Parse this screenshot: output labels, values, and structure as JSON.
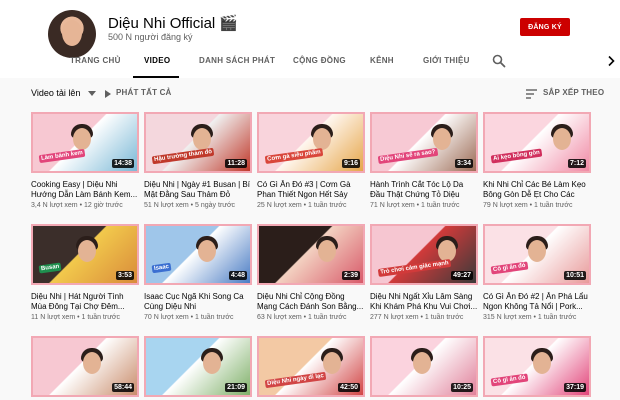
{
  "channel": {
    "name": "Diệu Nhi Official 🎬",
    "subscribers": "500 N người đăng ký",
    "subscribe_label": "ĐĂNG KÝ"
  },
  "tabs": [
    {
      "label": "TRANG CHỦ",
      "active": false
    },
    {
      "label": "VIDEO",
      "active": true
    },
    {
      "label": "DANH SÁCH PHÁT",
      "active": false
    },
    {
      "label": "CỘNG ĐỒNG",
      "active": false
    },
    {
      "label": "KÊNH",
      "active": false
    },
    {
      "label": "GIỚI THIỆU",
      "active": false
    }
  ],
  "toolbar": {
    "uploads_label": "Video tải lên",
    "play_all_label": "PHÁT TẤT CẢ",
    "sort_label": "SẮP XẾP THEO"
  },
  "videos": [
    {
      "title": "Cooking Easy | Diệu Nhi Hướng Dẫn Làm Bánh Kem...",
      "views": "3,4 N lượt xem",
      "age": "12 giờ trước",
      "duration": "14:38",
      "palette": [
        "#f7c8d2",
        "#7ab8d6",
        "#ffffff"
      ],
      "caption": "Làm bánh kem",
      "caption_bg": "#e2457a"
    },
    {
      "title": "Diệu Nhi | Ngày #1 Busan | Bí Mật Đằng Sau Thảm Đỏ",
      "views": "51 N lượt xem",
      "age": "5 ngày trước",
      "duration": "11:28",
      "palette": [
        "#f4d7dd",
        "#c0392b",
        "#f0f0f0"
      ],
      "caption": "Hậu trường thảm đỏ",
      "caption_bg": "#c0392b"
    },
    {
      "title": "Có Gì Ăn Đó #3 | Cơm Gà Phan Thiết Ngon Hết Sảy",
      "views": "25 N lượt xem",
      "age": "1 tuần trước",
      "duration": "9:16",
      "palette": [
        "#f9d4dc",
        "#e6a64a",
        "#fff7f0"
      ],
      "caption": "Cơm gà siêu phẩm",
      "caption_bg": "#d9463b"
    },
    {
      "title": "Hành Trình Cắt Tóc Lộ Da Đầu Thật Chứng Tỏ Diệu Nhi...",
      "views": "71 N lượt xem",
      "age": "1 tuần trước",
      "duration": "3:34",
      "palette": [
        "#f7c9d4",
        "#9c6b55",
        "#ffffff"
      ],
      "caption": "Diệu Nhi sẽ ra sao?",
      "caption_bg": "#e2457a"
    },
    {
      "title": "Khi Nhi Chỉ Các Bé Làm Kẹo Bông Gòn Dễ Ẹt Cho Các Bé...",
      "views": "79 N lượt xem",
      "age": "1 tuần trước",
      "duration": "7:12",
      "palette": [
        "#fbd6df",
        "#f08aa5",
        "#ffffff"
      ],
      "caption": "Ai kẹo bông gòn",
      "caption_bg": "#d12f5d"
    },
    {
      "title": "Diệu Nhi | Hát Người Tình Mùa Đông Tại Chợ Đêm...",
      "views": "11 N lượt xem",
      "age": "1 tuần trước",
      "duration": "3:53",
      "palette": [
        "#3b2e2a",
        "#d98b3a",
        "#f2c94c"
      ],
      "caption": "Busan",
      "caption_bg": "#1f8f4e"
    },
    {
      "title": "Isaac Cục Ngã Khi Song Ca Cùng Diệu Nhi",
      "views": "70 N lượt xem",
      "age": "1 tuần trước",
      "duration": "4:48",
      "palette": [
        "#9fc6ea",
        "#4a7cc4",
        "#ffffff"
      ],
      "caption": "Isaac",
      "caption_bg": "#3b6fd1"
    },
    {
      "title": "Diệu Nhi Chỉ Cộng Đồng Mạng Cách Đánh Son Bằng...",
      "views": "63 N lượt xem",
      "age": "1 tuần trước",
      "duration": "2:39",
      "palette": [
        "#2b1e1a",
        "#d85a6a",
        "#f3d1c1"
      ],
      "caption": "",
      "caption_bg": "#000000"
    },
    {
      "title": "Diệu Nhi Ngất Xỉu Lâm Sàng Khi Khám Phá Khu Vui Chơi...",
      "views": "277 N lượt xem",
      "age": "1 tuần trước",
      "duration": "49:27",
      "palette": [
        "#f6c6d1",
        "#3a3a3a",
        "#d13a3a"
      ],
      "caption": "Trò chơi cảm giác mạnh",
      "caption_bg": "#d13a3a"
    },
    {
      "title": "Có Gì Ăn Đó #2 | Ăn Phá Lẩu Ngon Không Tả Nổi | Pork...",
      "views": "315 N lượt xem",
      "age": "1 tuần trước",
      "duration": "10:51",
      "palette": [
        "#fbe1e6",
        "#e89a9a",
        "#ffffff"
      ],
      "caption": "Có gì ăn đó",
      "caption_bg": "#e2457a"
    },
    {
      "title": "",
      "views": "",
      "age": "",
      "duration": "58:44",
      "palette": [
        "#f7c8d2",
        "#c98c6b",
        "#ffffff"
      ],
      "caption": "",
      "caption_bg": "#000000"
    },
    {
      "title": "",
      "views": "",
      "age": "",
      "duration": "21:09",
      "palette": [
        "#a8d5f0",
        "#7fb069",
        "#ffffff"
      ],
      "caption": "",
      "caption_bg": "#000000"
    },
    {
      "title": "",
      "views": "",
      "age": "",
      "duration": "42:50",
      "palette": [
        "#f3c9a4",
        "#d14545",
        "#ffffff"
      ],
      "caption": "Diệu Nhi ngày đi lạc",
      "caption_bg": "#d14545"
    },
    {
      "title": "",
      "views": "",
      "age": "",
      "duration": "10:25",
      "palette": [
        "#fbd3de",
        "#e0809a",
        "#ffffff"
      ],
      "caption": "",
      "caption_bg": "#000000"
    },
    {
      "title": "",
      "views": "",
      "age": "",
      "duration": "37:19",
      "palette": [
        "#fbe1e6",
        "#e2457a",
        "#ffffff"
      ],
      "caption": "Có gì ăn đó",
      "caption_bg": "#e2457a"
    }
  ]
}
